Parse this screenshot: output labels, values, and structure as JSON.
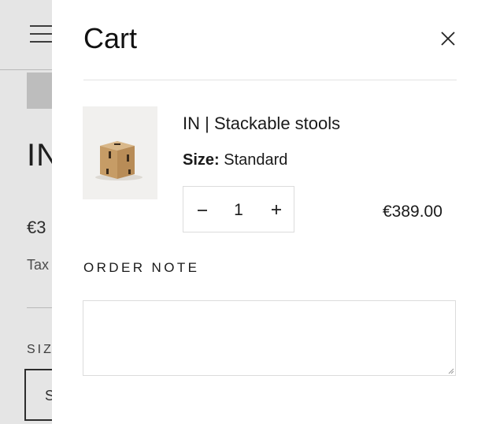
{
  "background_page": {
    "title_fragment": "IN",
    "price_fragment": "€3",
    "tax_fragment": "Tax",
    "size_label_fragment": "SIZ",
    "size_option_fragment": "S"
  },
  "cart": {
    "title": "Cart",
    "items": [
      {
        "title": "IN | Stackable stools",
        "variant_label": "Size:",
        "variant_value": "Standard",
        "quantity": "1",
        "price": "€389.00"
      }
    ],
    "order_note": {
      "label": "ORDER NOTE",
      "value": ""
    }
  },
  "icons": {
    "close": "close-icon",
    "minus": "minus-icon",
    "plus": "plus-icon",
    "menu": "menu-icon"
  }
}
